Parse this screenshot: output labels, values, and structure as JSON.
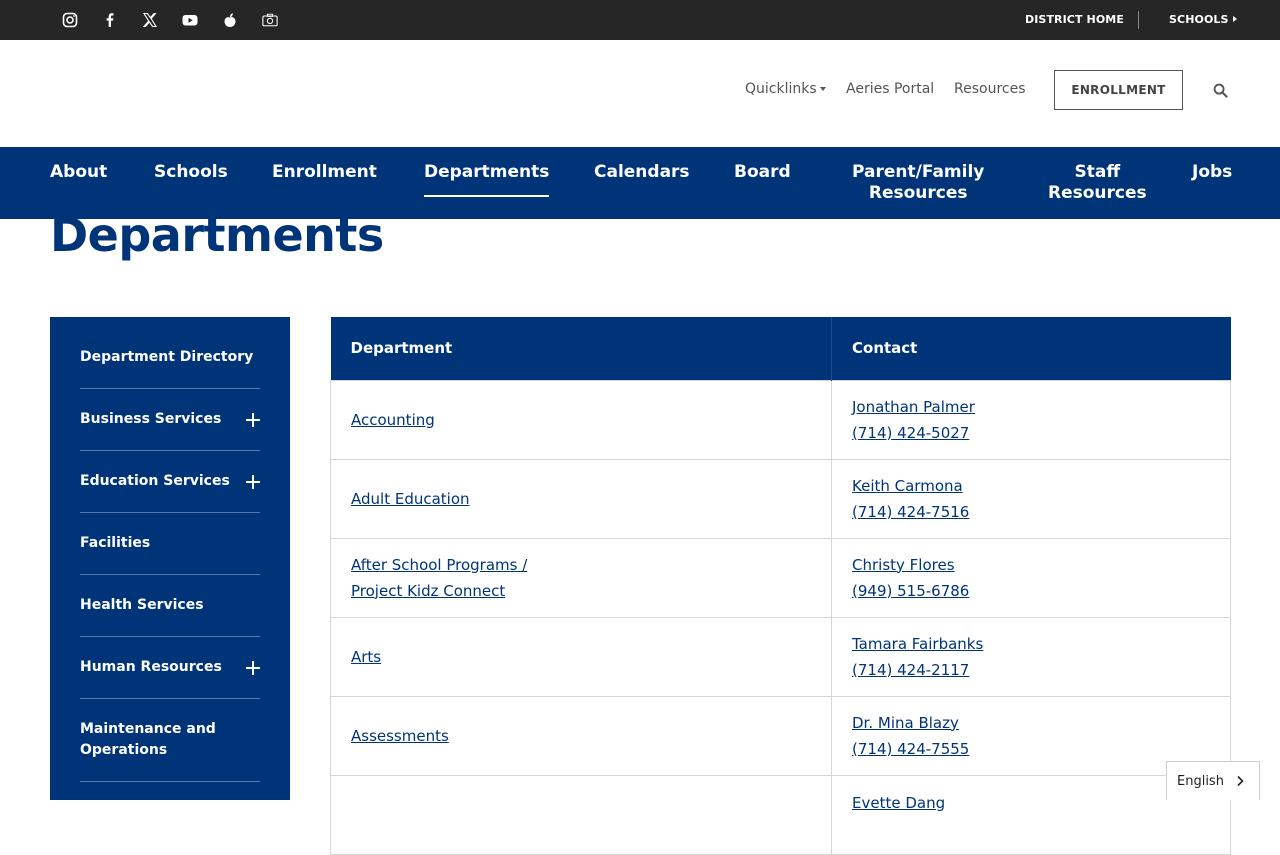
{
  "topbar": {
    "social_icons": [
      "instagram-icon",
      "facebook-icon",
      "x-twitter-icon",
      "youtube-icon",
      "peachjar-icon",
      "photo-gallery-icon"
    ],
    "district_home": "DISTRICT HOME",
    "schools": "SCHOOLS"
  },
  "header": {
    "quicklinks": "Quicklinks",
    "aeries_portal": "Aeries Portal",
    "resources": "Resources",
    "enrollment_button": "ENROLLMENT",
    "search_icon": "search-icon"
  },
  "nav": {
    "about": "About",
    "schools": "Schools",
    "enrollment": "Enrollment",
    "departments": "Departments",
    "calendars": "Calendars",
    "board": "Board",
    "parent_family_1": "Parent/Family",
    "parent_family_2": "Resources",
    "staff_1": "Staff",
    "staff_2": "Resources",
    "jobs": "Jobs"
  },
  "page": {
    "title": "Departments"
  },
  "sidebar": {
    "items": [
      "Department Directory",
      "Business Services",
      "Education Services",
      "Facilities",
      "Health Services",
      "Human Resources",
      "Maintenance and Operations"
    ]
  },
  "table": {
    "headers": [
      "Department",
      "Contact"
    ],
    "rows": [
      {
        "department": [
          "Accounting"
        ],
        "contact_name": "Jonathan Palmer",
        "contact_phone": "(714) 424-5027"
      },
      {
        "department": [
          "Adult Education"
        ],
        "contact_name": "Keith Carmona",
        "contact_phone": "(714) 424-7516"
      },
      {
        "department": [
          "After School Programs /",
          "Project Kidz Connect"
        ],
        "contact_name": "Christy Flores",
        "contact_phone": "(949) 515-6786"
      },
      {
        "department": [
          "Arts"
        ],
        "contact_name": "Tamara Fairbanks",
        "contact_phone": "(714) 424-2117"
      },
      {
        "department": [
          "Assessments"
        ],
        "contact_name": "Dr. Mina Blazy",
        "contact_phone": "(714) 424-7555"
      },
      {
        "department": [
          ""
        ],
        "contact_name": "Evette Dang",
        "contact_phone": ""
      }
    ]
  },
  "language": {
    "selected": "English"
  },
  "colors": {
    "brand_blue": "#003478",
    "topbar": "#262626"
  }
}
